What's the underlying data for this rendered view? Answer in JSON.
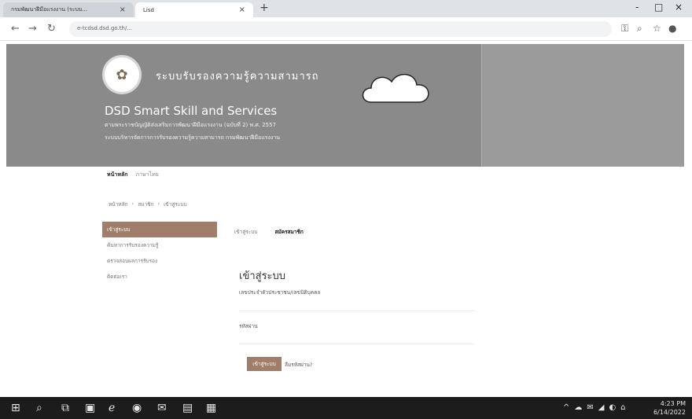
{
  "browser": {
    "tab1_title": "กรมพัฒนาฝีมือแรงงาน (ระบบ...",
    "tab2_title": "Lisd",
    "url": "e-tcdsd.dsd.go.th/...",
    "new_tab_label": "+",
    "minimize": "-",
    "maximize": "□",
    "close": "×"
  },
  "hero": {
    "thai_title": "ระบบรับรองความรู้ความสามารถ",
    "title": "DSD Smart Skill and Services",
    "sub1": "ตามพระราชบัญญัติส่งเสริมการพัฒนาฝีมือแรงงาน (ฉบับที่ 2) พ.ศ. 2557",
    "sub2": "ระบบบริหารจัดการการรับรองความรู้ความสามารถ กรมพัฒนาฝีมือแรงงาน"
  },
  "topnav": {
    "item1": "หน้าหลัก",
    "item2": "ภาษาไทย"
  },
  "breadcrumb": {
    "home": "หน้าหลัก",
    "sep": "›",
    "item2": "สมาชิก",
    "sep2": "›",
    "item3": "เข้าสู่ระบบ"
  },
  "sidebar": {
    "items": [
      {
        "label": "เข้าสู่ระบบ"
      },
      {
        "label": "ค้นหาการรับรองความรู้"
      },
      {
        "label": "ตรวจสอบผลการรับรอง"
      },
      {
        "label": "ติดต่อเรา"
      }
    ]
  },
  "login_tabs": {
    "signin": "เข้าสู่ระบบ",
    "register": "สมัครสมาชิก"
  },
  "login": {
    "title": "เข้าสู่ระบบ",
    "id_label": "เลขประจำตัวประชาชน/เลขนิติบุคคล",
    "pw_label": "รหัสผ่าน",
    "button": "เข้าสู่ระบบ",
    "forgot": "ลืมรหัสผ่าน?"
  },
  "taskbar": {
    "time": "4:23 PM",
    "date": "6/14/2022"
  }
}
